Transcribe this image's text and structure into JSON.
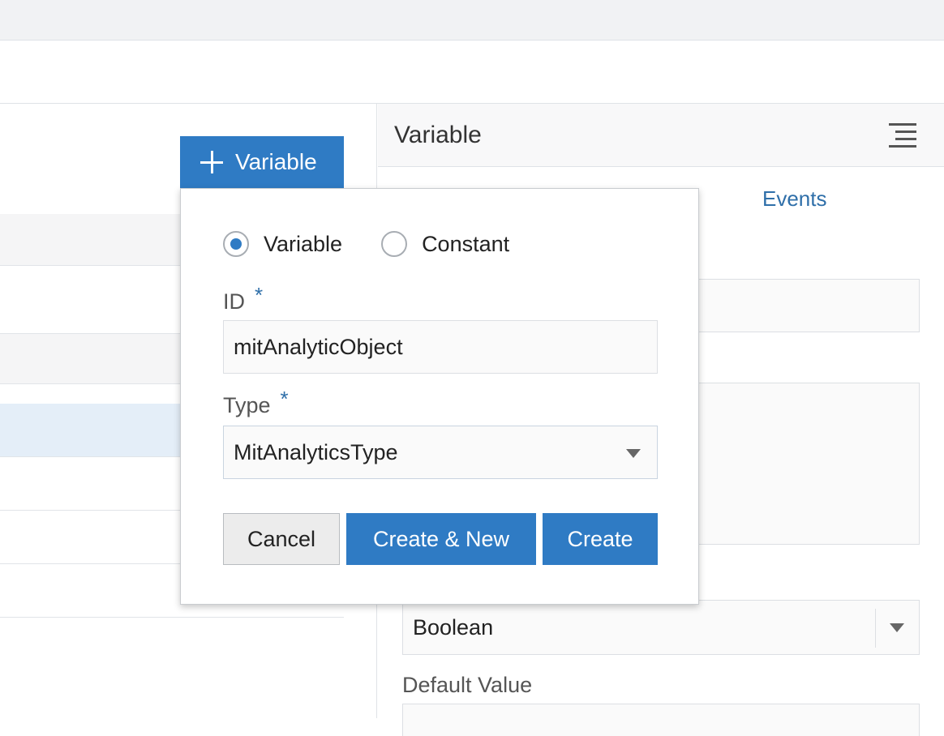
{
  "add_button": {
    "label": "Variable"
  },
  "right_panel": {
    "title": "Variable",
    "events_tab": "Events",
    "type_select_value": "Boolean",
    "default_value_label": "Default Value"
  },
  "popup": {
    "radio_variable": "Variable",
    "radio_constant": "Constant",
    "selected_radio": "Variable",
    "id_label": "ID",
    "id_value": "mitAnalyticObject",
    "type_label": "Type",
    "type_value": "MitAnalyticsType",
    "required_marker": "*",
    "cancel_label": "Cancel",
    "create_new_label": "Create & New",
    "create_label": "Create"
  },
  "colors": {
    "accent": "#2f7bc4",
    "link": "#2f6fa9",
    "selected_row": "#e4eef8"
  }
}
